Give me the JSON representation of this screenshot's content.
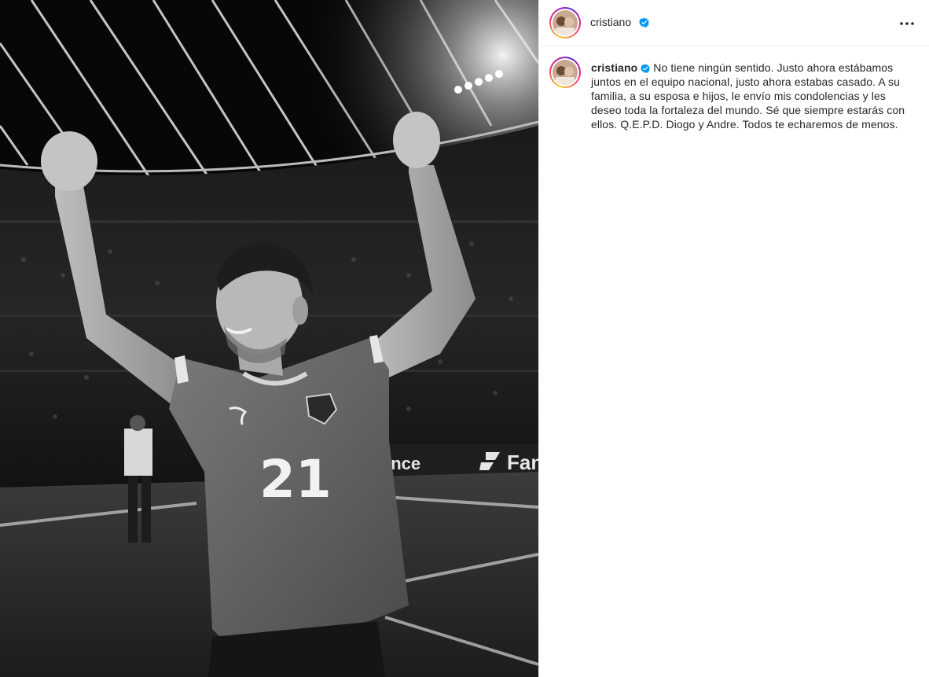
{
  "post": {
    "username": "cristiano",
    "verified": true,
    "caption": "No tiene ningún sentido. Justo ahora estábamos juntos en el equipo nacional, justo ahora estabas casado. A su familia, a su esposa e hijos, le envío mis condolencias y les deseo toda la fortaleza del mundo. Sé que siempre estarás con ellos. Q.E.P.D. Diogo y Andre. Todos te echaremos de menos.",
    "more_icon": "more-horizontal-icon",
    "verified_icon": "verified-badge-icon"
  },
  "photo": {
    "jersey_number": "21",
    "board_text": "Fane",
    "board_text_left": "ance"
  },
  "colors": {
    "verified_blue": "#0095f6",
    "border": "#efefef",
    "text": "#262626"
  }
}
